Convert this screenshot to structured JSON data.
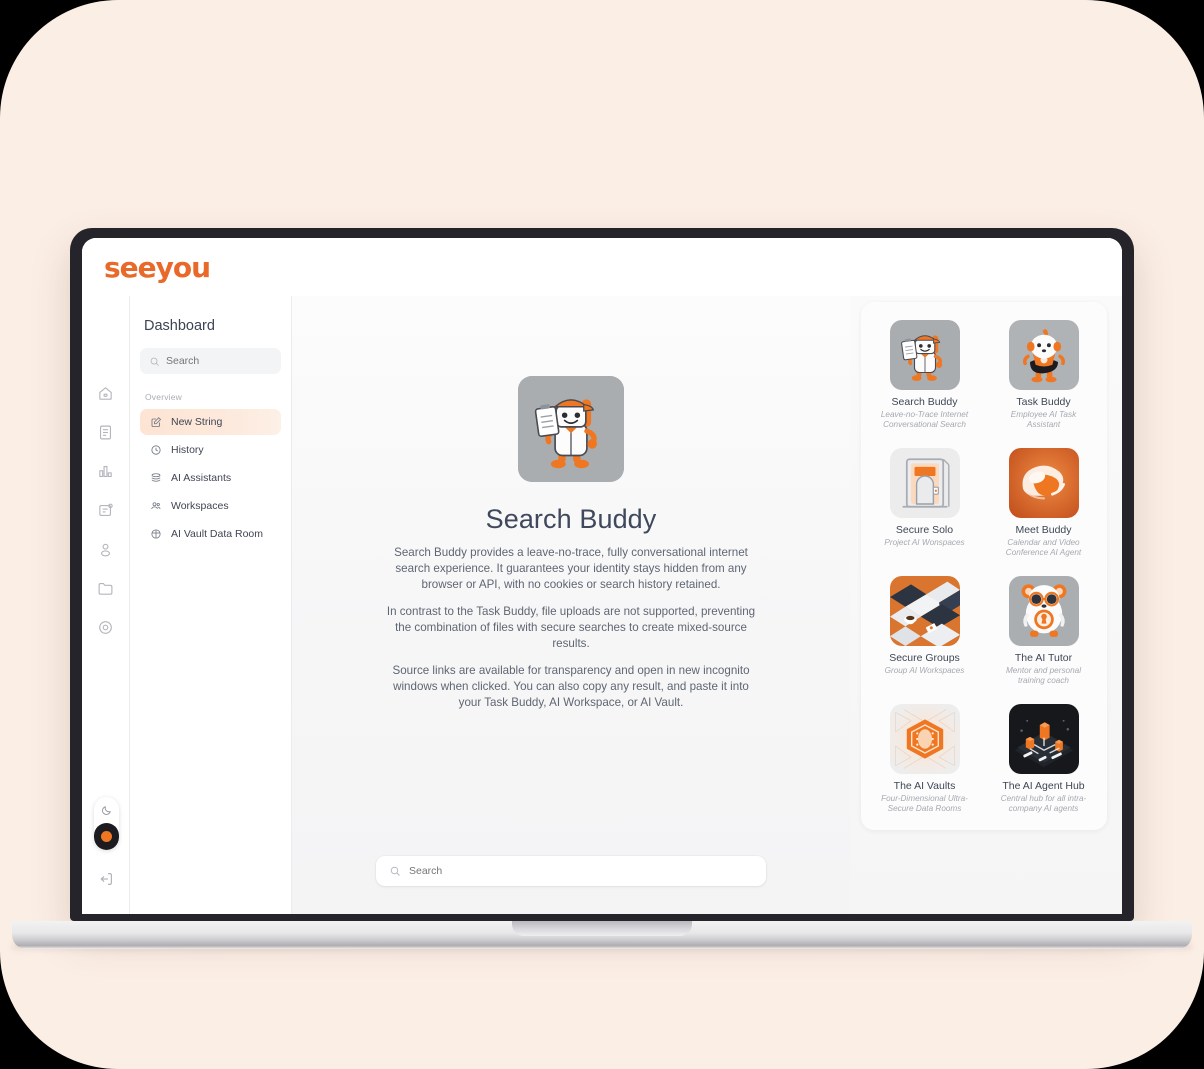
{
  "brand": {
    "logo_text": "seeyou",
    "accent": "#e8692a"
  },
  "icon_rail": {
    "items": [
      {
        "name": "home-icon"
      },
      {
        "name": "document-icon"
      },
      {
        "name": "chart-bar-icon"
      },
      {
        "name": "note-badge-icon"
      },
      {
        "name": "user-icon"
      },
      {
        "name": "folder-icon"
      },
      {
        "name": "target-icon"
      }
    ],
    "theme_toggle": {
      "name": "dark-mode-toggle",
      "moon_icon": "moon-icon"
    },
    "logout": {
      "name": "logout-icon"
    }
  },
  "sidebar": {
    "title": "Dashboard",
    "search": {
      "value": "",
      "placeholder": "Search"
    },
    "section_label": "Overview",
    "items": [
      {
        "label": "New String",
        "icon": "edit-square-icon",
        "active": true
      },
      {
        "label": "History",
        "icon": "clock-icon",
        "active": false
      },
      {
        "label": "AI Assistants",
        "icon": "layers-icon",
        "active": false
      },
      {
        "label": "Workspaces",
        "icon": "users-icon",
        "active": false
      },
      {
        "label": "AI Vault Data Room",
        "icon": "globe-icon",
        "active": false
      }
    ]
  },
  "main": {
    "hero_avatar_name": "search-buddy-mascot",
    "title": "Search Buddy",
    "paragraphs": [
      "Search Buddy provides a leave-no-trace, fully conversational internet search experience. It guarantees your identity stays hidden from any browser or API, with no cookies or search history retained.",
      "In contrast to the Task Buddy, file uploads are not supported, preventing the combination of files with secure searches to create mixed-source results.",
      "Source links are available for transparency and open in new incognito windows when clicked. You can also copy any result, and paste it into your Task Buddy, AI Workspace, or AI Vault."
    ],
    "search": {
      "value": "",
      "placeholder": "Search"
    }
  },
  "assistants": [
    {
      "name": "Search Buddy",
      "desc": "Leave-no-Trace Internet Conversational Search",
      "art": "search-buddy",
      "bg": "#a9adb0"
    },
    {
      "name": "Task Buddy",
      "desc": "Employee AI Task Assistant",
      "art": "task-buddy",
      "bg": "#b0b3b6"
    },
    {
      "name": "Secure Solo",
      "desc": "Project AI Wonspaces",
      "art": "secure-solo",
      "bg": "#ececed"
    },
    {
      "name": "Meet Buddy",
      "desc": "Calendar and Video Conference AI Agent",
      "art": "meet-buddy",
      "bg": "#d9622a"
    },
    {
      "name": "Secure Groups",
      "desc": "Group AI Workspaces",
      "art": "secure-groups",
      "bg": "#d9752f"
    },
    {
      "name": "The AI Tutor",
      "desc": "Mentor and personal training coach",
      "art": "ai-tutor",
      "bg": "#aaaeb1"
    },
    {
      "name": "The AI Vaults",
      "desc": "Four-Dimensional Ultra-Secure Data Rooms",
      "art": "ai-vaults",
      "bg": "#eeeded"
    },
    {
      "name": "The AI Agent Hub",
      "desc": "Central hub for all intra-company AI agents",
      "art": "agent-hub",
      "bg": "#16181c"
    }
  ]
}
